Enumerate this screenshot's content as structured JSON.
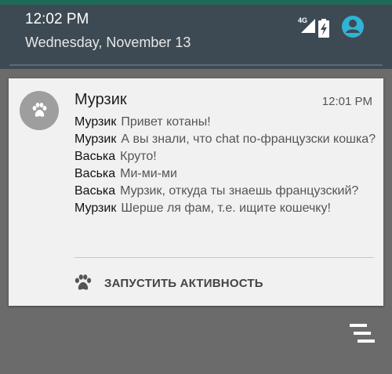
{
  "status_bar": {
    "time": "12:02 PM",
    "date": "Wednesday, November 13",
    "network_label": "4G",
    "icons": [
      "signal-icon",
      "battery-charging-icon",
      "account-avatar-icon"
    ]
  },
  "notification": {
    "app_icon": "paw-icon",
    "title": "Мурзик",
    "time": "12:01 PM",
    "messages": [
      {
        "sender": "Мурзик",
        "text": "Привет котаны!"
      },
      {
        "sender": "Мурзик",
        "text": "А вы знали, что chat по-французски кошка?"
      },
      {
        "sender": "Васька",
        "text": "Круто!"
      },
      {
        "sender": "Васька",
        "text": "Ми-ми-ми"
      },
      {
        "sender": "Васька",
        "text": "Мурзик, откуда ты знаешь французский?"
      },
      {
        "sender": "Мурзик",
        "text": "Шерше ля фам, т.е. ищите кошечку!"
      }
    ],
    "action": {
      "icon": "paw-icon",
      "label": "ЗАПУСТИТЬ АКТИВНОСТЬ"
    }
  },
  "controls": {
    "clear_all_icon": "clear-all-icon"
  },
  "colors": {
    "shade_background": "#3d4a54",
    "accent_avatar": "#2fb3d6",
    "card_background": "#f1f1f1",
    "scrim": "#6b6b6b"
  }
}
